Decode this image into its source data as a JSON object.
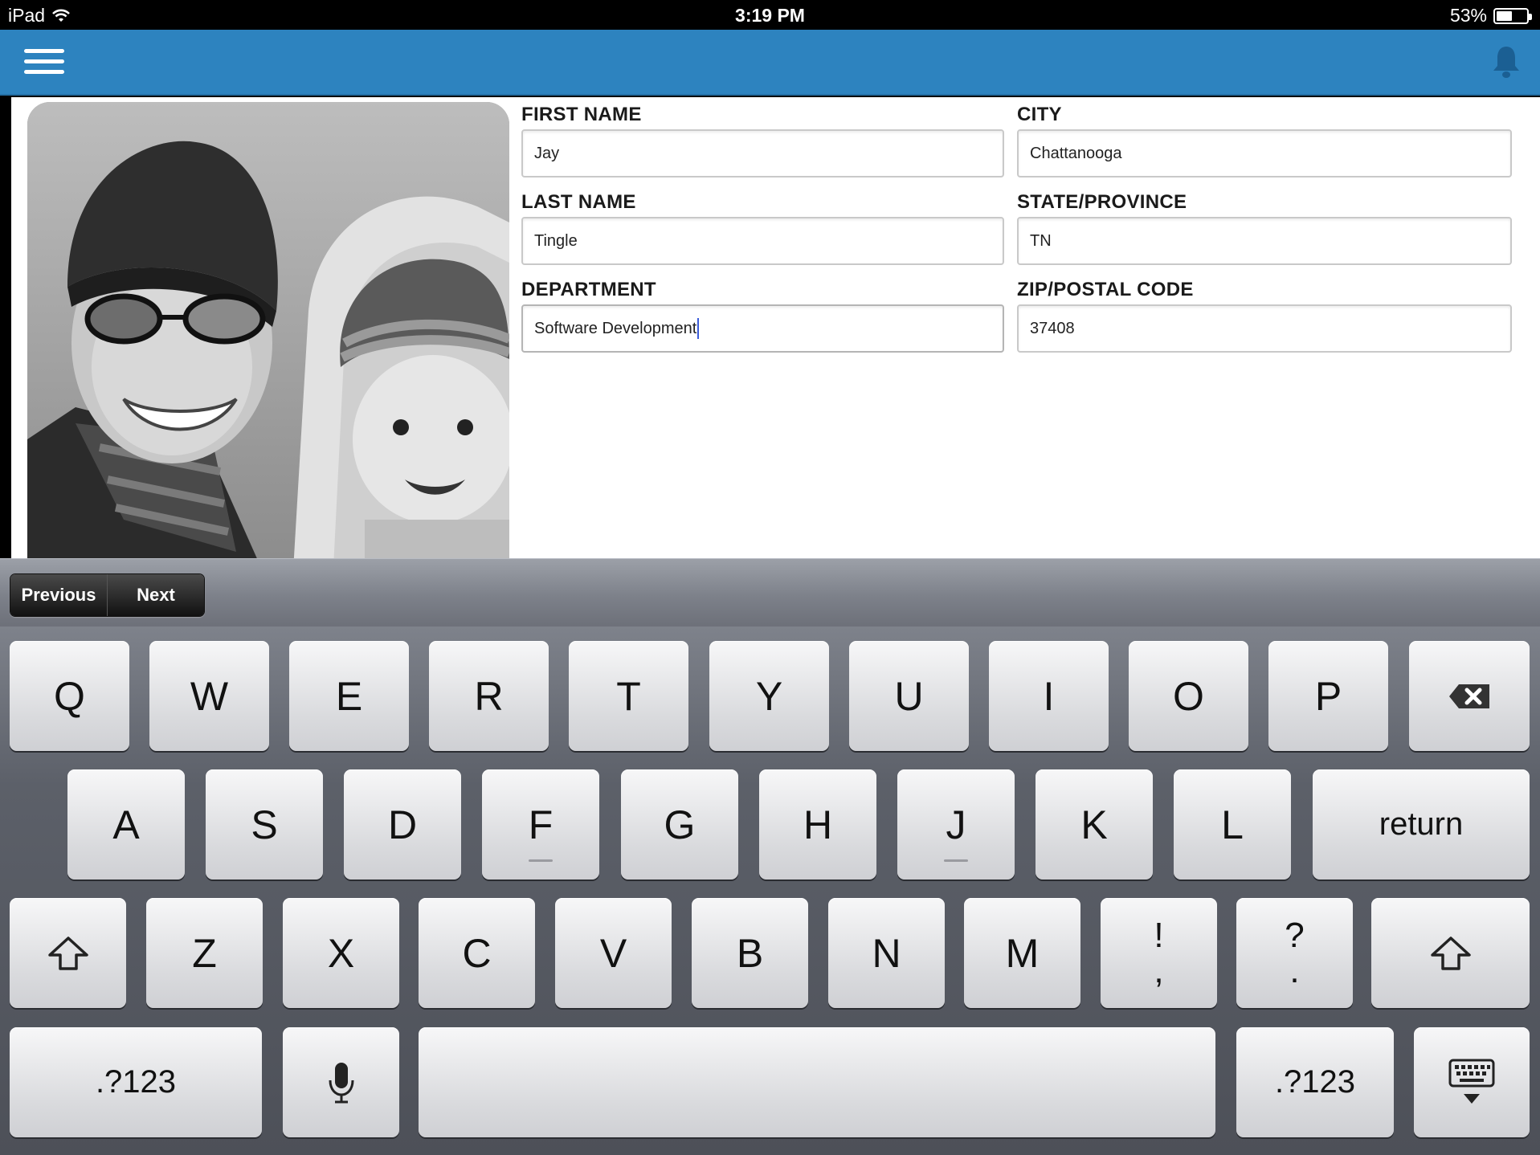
{
  "status": {
    "device": "iPad",
    "time": "3:19 PM",
    "battery": "53%",
    "battery_level": 0.53
  },
  "header": {
    "menu_icon": "hamburger-menu-icon",
    "notification_icon": "bell-icon",
    "brand_color": "#2d83bf"
  },
  "profile": {
    "photo": "profile-photo"
  },
  "form": {
    "first_name": {
      "label": "FIRST NAME",
      "value": "Jay"
    },
    "last_name": {
      "label": "LAST NAME",
      "value": "Tingle"
    },
    "department": {
      "label": "DEPARTMENT",
      "value": "Software Development"
    },
    "city": {
      "label": "CITY",
      "value": "Chattanooga"
    },
    "state": {
      "label": "STATE/PROVINCE",
      "value": "TN"
    },
    "zip": {
      "label": "ZIP/POSTAL CODE",
      "value": "37408"
    }
  },
  "accessory": {
    "previous": "Previous",
    "next": "Next"
  },
  "keyboard": {
    "row1": [
      "Q",
      "W",
      "E",
      "R",
      "T",
      "Y",
      "U",
      "I",
      "O",
      "P"
    ],
    "row2": [
      "A",
      "S",
      "D",
      "F",
      "G",
      "H",
      "J",
      "K",
      "L"
    ],
    "return": "return",
    "row3": [
      "Z",
      "X",
      "C",
      "V",
      "B",
      "N",
      "M"
    ],
    "punct1_top": "!",
    "punct1_bottom": ",",
    "punct2_top": "?",
    "punct2_bottom": ".",
    "numbers_left": ".?123",
    "numbers_right": ".?123"
  }
}
